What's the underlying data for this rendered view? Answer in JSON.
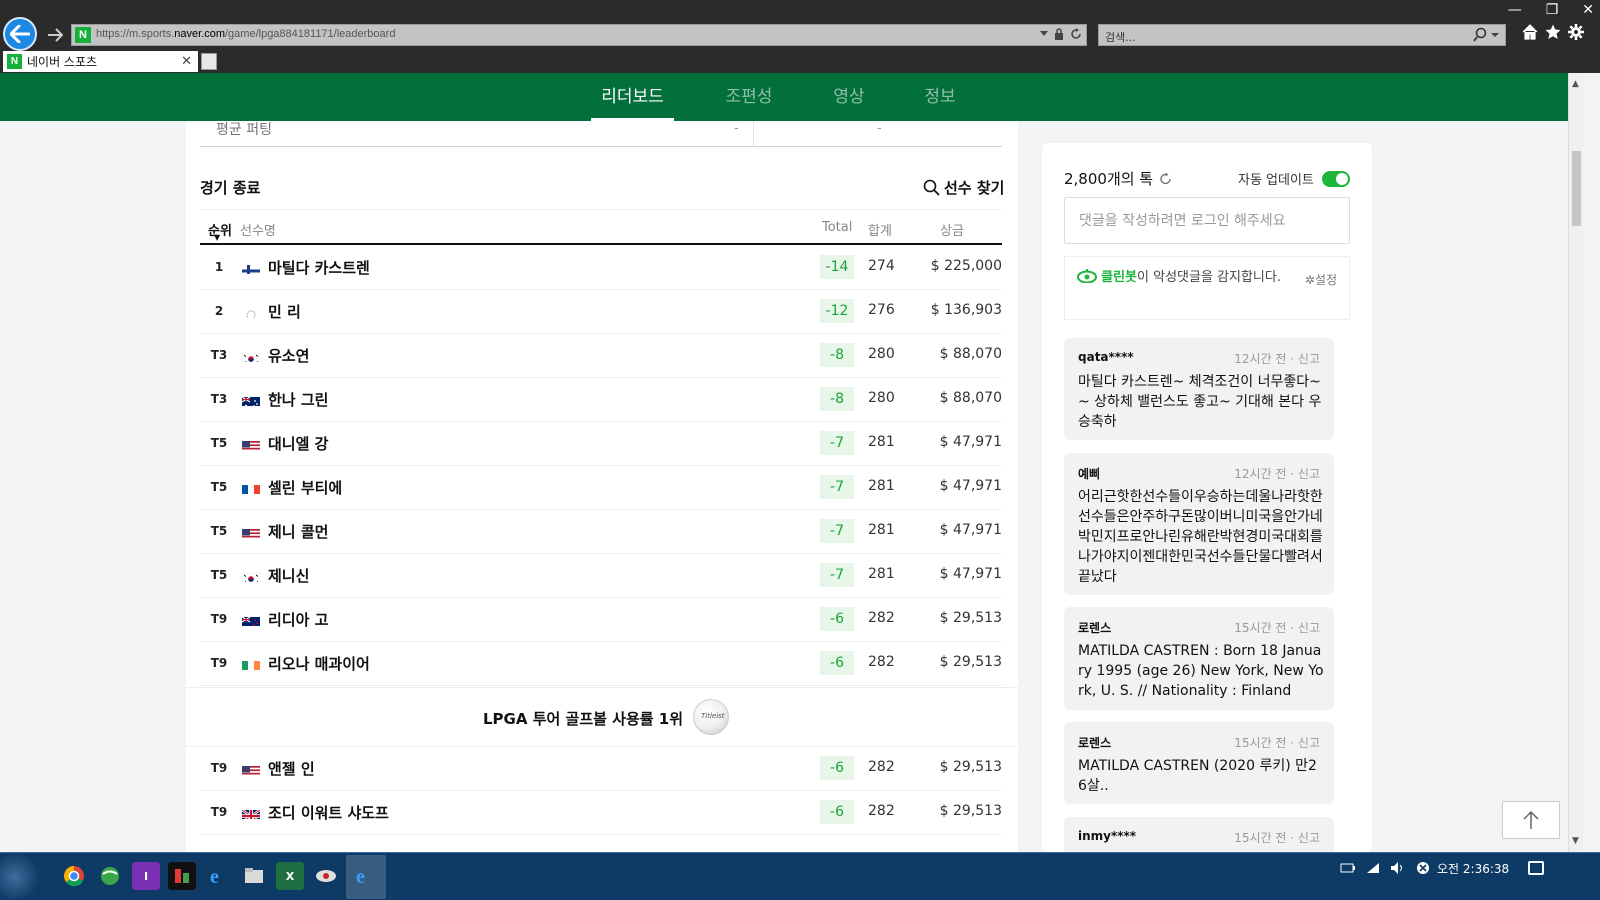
{
  "browser": {
    "url_prefix": "https://m.sports.",
    "url_domain": "naver.com",
    "url_path": "/game/lpga884181171/leaderboard",
    "search_placeholder": "검색...",
    "tab_title": "네이버 스포츠",
    "favicon_letter": "N"
  },
  "nav": {
    "tabs": [
      "리더보드",
      "조편성",
      "영상",
      "정보"
    ],
    "active": 0
  },
  "stats": {
    "label": "평균 퍼팅",
    "value1": "-",
    "value2": "-"
  },
  "leaderboard": {
    "status": "경기 종료",
    "find_label": "선수 찾기",
    "headers": {
      "rank": "순위",
      "name": "선수명",
      "total": "Total",
      "sum": "합계",
      "prize": "상금"
    },
    "rows": [
      {
        "rank": "1",
        "flag": "finland",
        "name": "마틸다 카스트렌",
        "score": "-14",
        "total": "274",
        "prize": "$ 225,000"
      },
      {
        "rank": "2",
        "flag": "other",
        "name": "민 리",
        "score": "-12",
        "total": "276",
        "prize": "$ 136,903"
      },
      {
        "rank": "T3",
        "flag": "korea",
        "name": "유소연",
        "score": "-8",
        "total": "280",
        "prize": "$ 88,070"
      },
      {
        "rank": "T3",
        "flag": "australia",
        "name": "한나 그린",
        "score": "-8",
        "total": "280",
        "prize": "$ 88,070"
      },
      {
        "rank": "T5",
        "flag": "usa",
        "name": "대니엘 강",
        "score": "-7",
        "total": "281",
        "prize": "$ 47,971"
      },
      {
        "rank": "T5",
        "flag": "france",
        "name": "셀린 부티에",
        "score": "-7",
        "total": "281",
        "prize": "$ 47,971"
      },
      {
        "rank": "T5",
        "flag": "usa",
        "name": "제니 콜먼",
        "score": "-7",
        "total": "281",
        "prize": "$ 47,971"
      },
      {
        "rank": "T5",
        "flag": "korea",
        "name": "제니신",
        "score": "-7",
        "total": "281",
        "prize": "$ 47,971"
      },
      {
        "rank": "T9",
        "flag": "newzealand",
        "name": "리디아 고",
        "score": "-6",
        "total": "282",
        "prize": "$ 29,513"
      },
      {
        "rank": "T9",
        "flag": "ireland",
        "name": "리오나 매과이어",
        "score": "-6",
        "total": "282",
        "prize": "$ 29,513"
      }
    ],
    "rows_after_ad": [
      {
        "rank": "T9",
        "flag": "usa",
        "name": "앤젤 인",
        "score": "-6",
        "total": "282",
        "prize": "$ 29,513"
      },
      {
        "rank": "T9",
        "flag": "uk",
        "name": "조디 이워트 샤도프",
        "score": "-6",
        "total": "282",
        "prize": "$ 29,513"
      }
    ],
    "ad_text": "LPGA 투어 골프볼 사용률 1위",
    "ad_ball_brand": "Titleist"
  },
  "comments": {
    "count_text": "2,800개의 톡",
    "auto_update_label": "자동 업데이트",
    "auto_update_on": true,
    "input_placeholder": "댓글을 작성하려면 로그인 해주세요",
    "cleanbot_name": "클린봇",
    "cleanbot_text": "이 악성댓글을 감지합니다.",
    "settings_label": "설정",
    "items": [
      {
        "author": "qata****",
        "meta": "12시간 전 · 신고",
        "body": "마틸다 카스트렌~ 체격조건이 너무좋다~~ 상하체 밸런스도 좋고~ 기대해 본다 우승축하"
      },
      {
        "author": "예삐",
        "meta": "12시간 전 · 신고",
        "body": "어리근핫한선수들이우승하는데울나라핫한선수들은안주하구돈많이버니미국을안가네박민지프로안나린유해란박현경미국대회를나가야지이젠대한민국선수들단물다빨려서끝났다"
      },
      {
        "author": "로렌스",
        "meta": "15시간 전 · 신고",
        "body": "MATILDA CASTREN : Born 18 January 1995 (age 26) New York, New York, U. S. // Nationality : Finland"
      },
      {
        "author": "로렌스",
        "meta": "15시간 전 · 신고",
        "body": "MATILDA CASTREN (2020 루키) 만26살.."
      },
      {
        "author": "inmy****",
        "meta": "15시간 전 · 신고",
        "body": ""
      }
    ]
  },
  "taskbar": {
    "clock": "오전 2:36:38"
  },
  "colors": {
    "nav_green": "#03703c",
    "score_green": "#17a63a",
    "score_bg": "#e7f6e9",
    "toggle_on": "#1db53c"
  }
}
